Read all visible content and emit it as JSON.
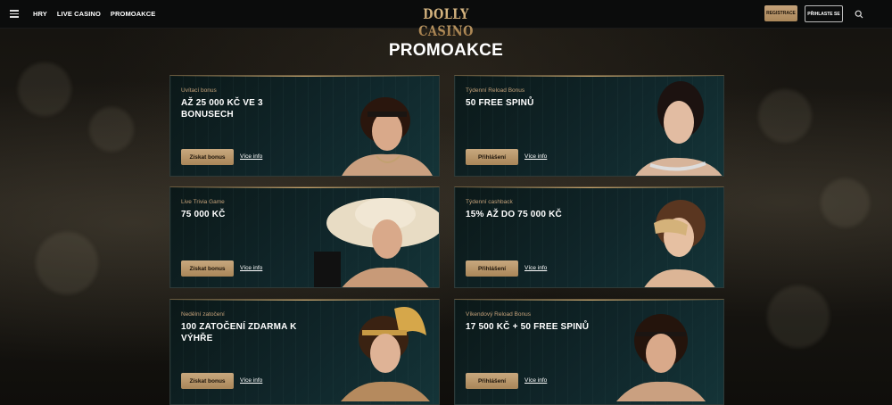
{
  "header": {
    "nav": [
      "HRY",
      "LIVE CASINO",
      "PROMOAKCE"
    ],
    "logo": "DOLLY CASINO",
    "register_label": "REGISTRACE",
    "login_label": "PŘIHLASTE SE"
  },
  "page_title": "PROMOAKCE",
  "promos": [
    {
      "subtitle": "Uvítací bonus",
      "title": "AŽ 25 000 KČ VE 3 BONUSECH",
      "button": "Získat bonus",
      "link": "Více info"
    },
    {
      "subtitle": "Týdenní Reload Bonus",
      "title": "50 FREE SPINŮ",
      "button": "Přihlášení",
      "link": "Více info"
    },
    {
      "subtitle": "Live Trivia Game",
      "title": "75 000 KČ",
      "button": "Získat bonus",
      "link": "Více info"
    },
    {
      "subtitle": "Týdenní cashback",
      "title": "15% AŽ DO 75 000 KČ",
      "button": "Přihlášení",
      "link": "Více info"
    },
    {
      "subtitle": "Nedělní zatočení",
      "title": "100 ZATOČENÍ ZDARMA K VÝHŘE",
      "button": "Získat bonus",
      "link": "Více info"
    },
    {
      "subtitle": "Víkendový Reload Bonus",
      "title": "17 500 KČ + 50 FREE SPINŮ",
      "button": "Přihlášení",
      "link": "Více info"
    }
  ]
}
